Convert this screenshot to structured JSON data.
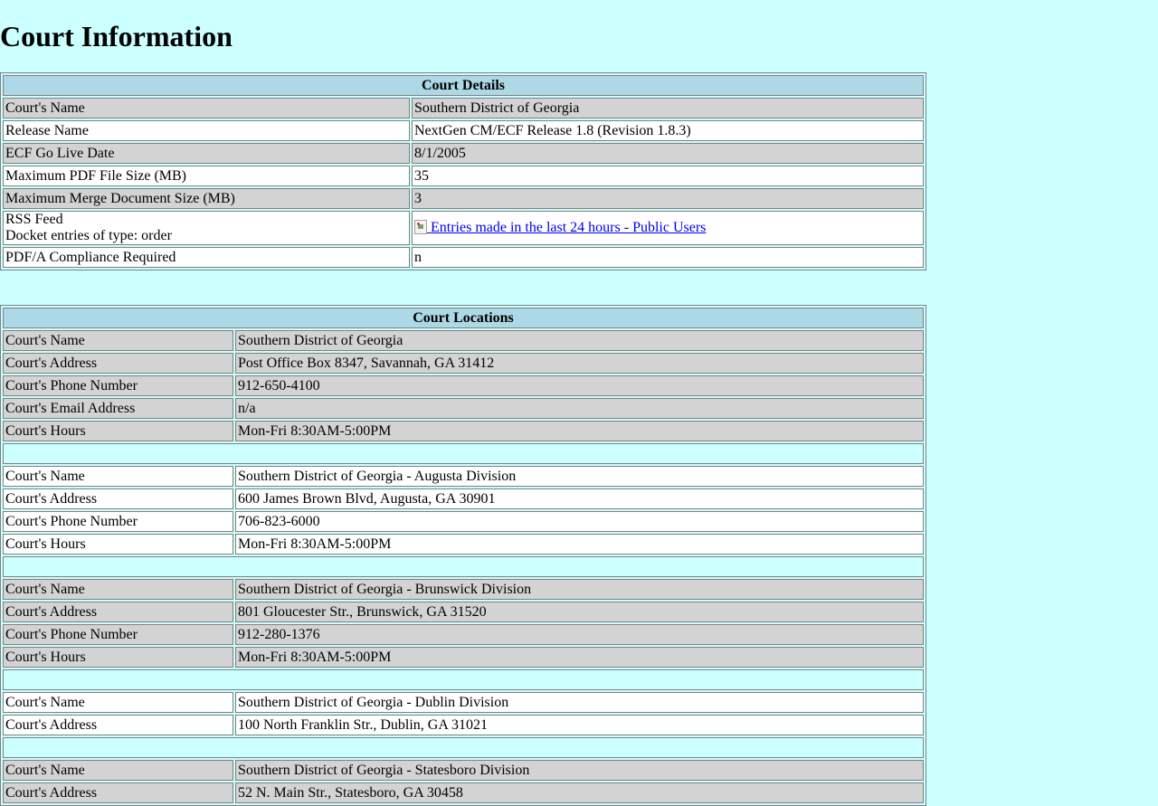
{
  "page": {
    "title": "Court Information"
  },
  "details": {
    "heading": "Court Details",
    "rows": [
      {
        "label": "Court's Name",
        "value": "Southern District of Georgia"
      },
      {
        "label": "Release Name",
        "value": "NextGen CM/ECF Release 1.8 (Revision 1.8.3)"
      },
      {
        "label": "ECF Go Live Date",
        "value": "8/1/2005"
      },
      {
        "label": "Maximum PDF File Size (MB)",
        "value": "35"
      },
      {
        "label": "Maximum Merge Document Size (MB)",
        "value": "3"
      }
    ],
    "rss": {
      "label_line1": "RSS Feed",
      "label_line2": "Docket entries of type: order",
      "link_text": " Entries made in the last 24 hours - Public Users"
    },
    "pdfa": {
      "label": "PDF/A Compliance Required",
      "value": "n"
    }
  },
  "locations": {
    "heading": "Court Locations",
    "labels": {
      "name": "Court's Name",
      "address": "Court's Address",
      "phone": "Court's Phone Number",
      "email": "Court's Email Address",
      "hours": "Court's Hours"
    },
    "items": [
      {
        "name": "Southern District of Georgia",
        "address": "Post Office Box 8347, Savannah, GA 31412",
        "phone": "912-650-4100",
        "email": "n/a",
        "hours": "Mon-Fri 8:30AM-5:00PM"
      },
      {
        "name": "Southern District of Georgia - Augusta Division",
        "address": "600 James Brown Blvd, Augusta, GA 30901",
        "phone": "706-823-6000",
        "hours": "Mon-Fri 8:30AM-5:00PM"
      },
      {
        "name": "Southern District of Georgia - Brunswick Division",
        "address": "801 Gloucester Str., Brunswick, GA 31520",
        "phone": "912-280-1376",
        "hours": "Mon-Fri 8:30AM-5:00PM"
      },
      {
        "name": "Southern District of Georgia - Dublin Division",
        "address": "100 North Franklin Str., Dublin, GA 31021"
      },
      {
        "name": "Southern District of Georgia - Statesboro Division",
        "address": "52 N. Main Str., Statesboro, GA 30458"
      }
    ]
  },
  "colors": {
    "page_bg": "#ccffff",
    "header_bg": "#add8e6",
    "row_gray": "#d3d3d3",
    "row_white": "#ffffff",
    "link": "#0000ee"
  }
}
